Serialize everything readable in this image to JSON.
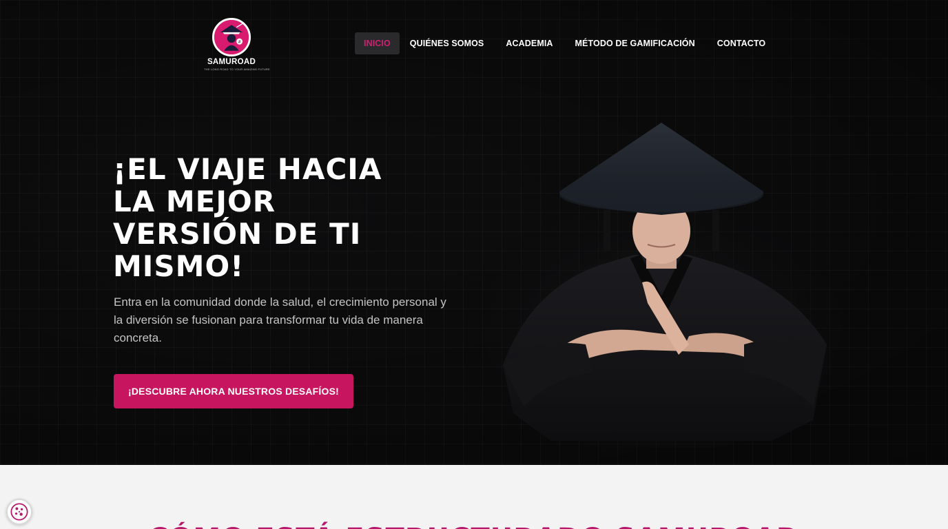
{
  "brand": {
    "name": "SAMUROAD",
    "tagline": "THE LONG ROAD TO YOUR AMAZING FUTURE",
    "logo_icon": "samurai-emblem-icon"
  },
  "nav": {
    "items": [
      {
        "label": "INICIO",
        "active": true
      },
      {
        "label": "QUIÉNES SOMOS",
        "active": false
      },
      {
        "label": "ACADEMIA",
        "active": false
      },
      {
        "label": "MÉTODO DE GAMIFICACIÓN",
        "active": false
      },
      {
        "label": "CONTACTO",
        "active": false
      }
    ]
  },
  "hero": {
    "headline": "¡EL VIAJE HACIA LA MEJOR VERSIÓN DE TI MISMO!",
    "subtext": "Entra en la comunidad donde la salud, el crecimiento personal y la diversión se fusionan para transformar tu vida de manera concreta.",
    "cta_label": "¡DESCUBRE AHORA NUESTROS DESAFÍOS!",
    "image": "samurai-in-straw-hat-photo"
  },
  "section": {
    "title": "CÓMO ESTÁ ESTRUCTURADO SAMUROAD"
  },
  "cookie": {
    "icon": "cookie-icon"
  },
  "colors": {
    "accent": "#c8155f",
    "accent_text": "#d11f74",
    "hero_bg": "#0d0d0e",
    "lower_bg": "#f3f3f4",
    "section_title": "#b5176a"
  }
}
